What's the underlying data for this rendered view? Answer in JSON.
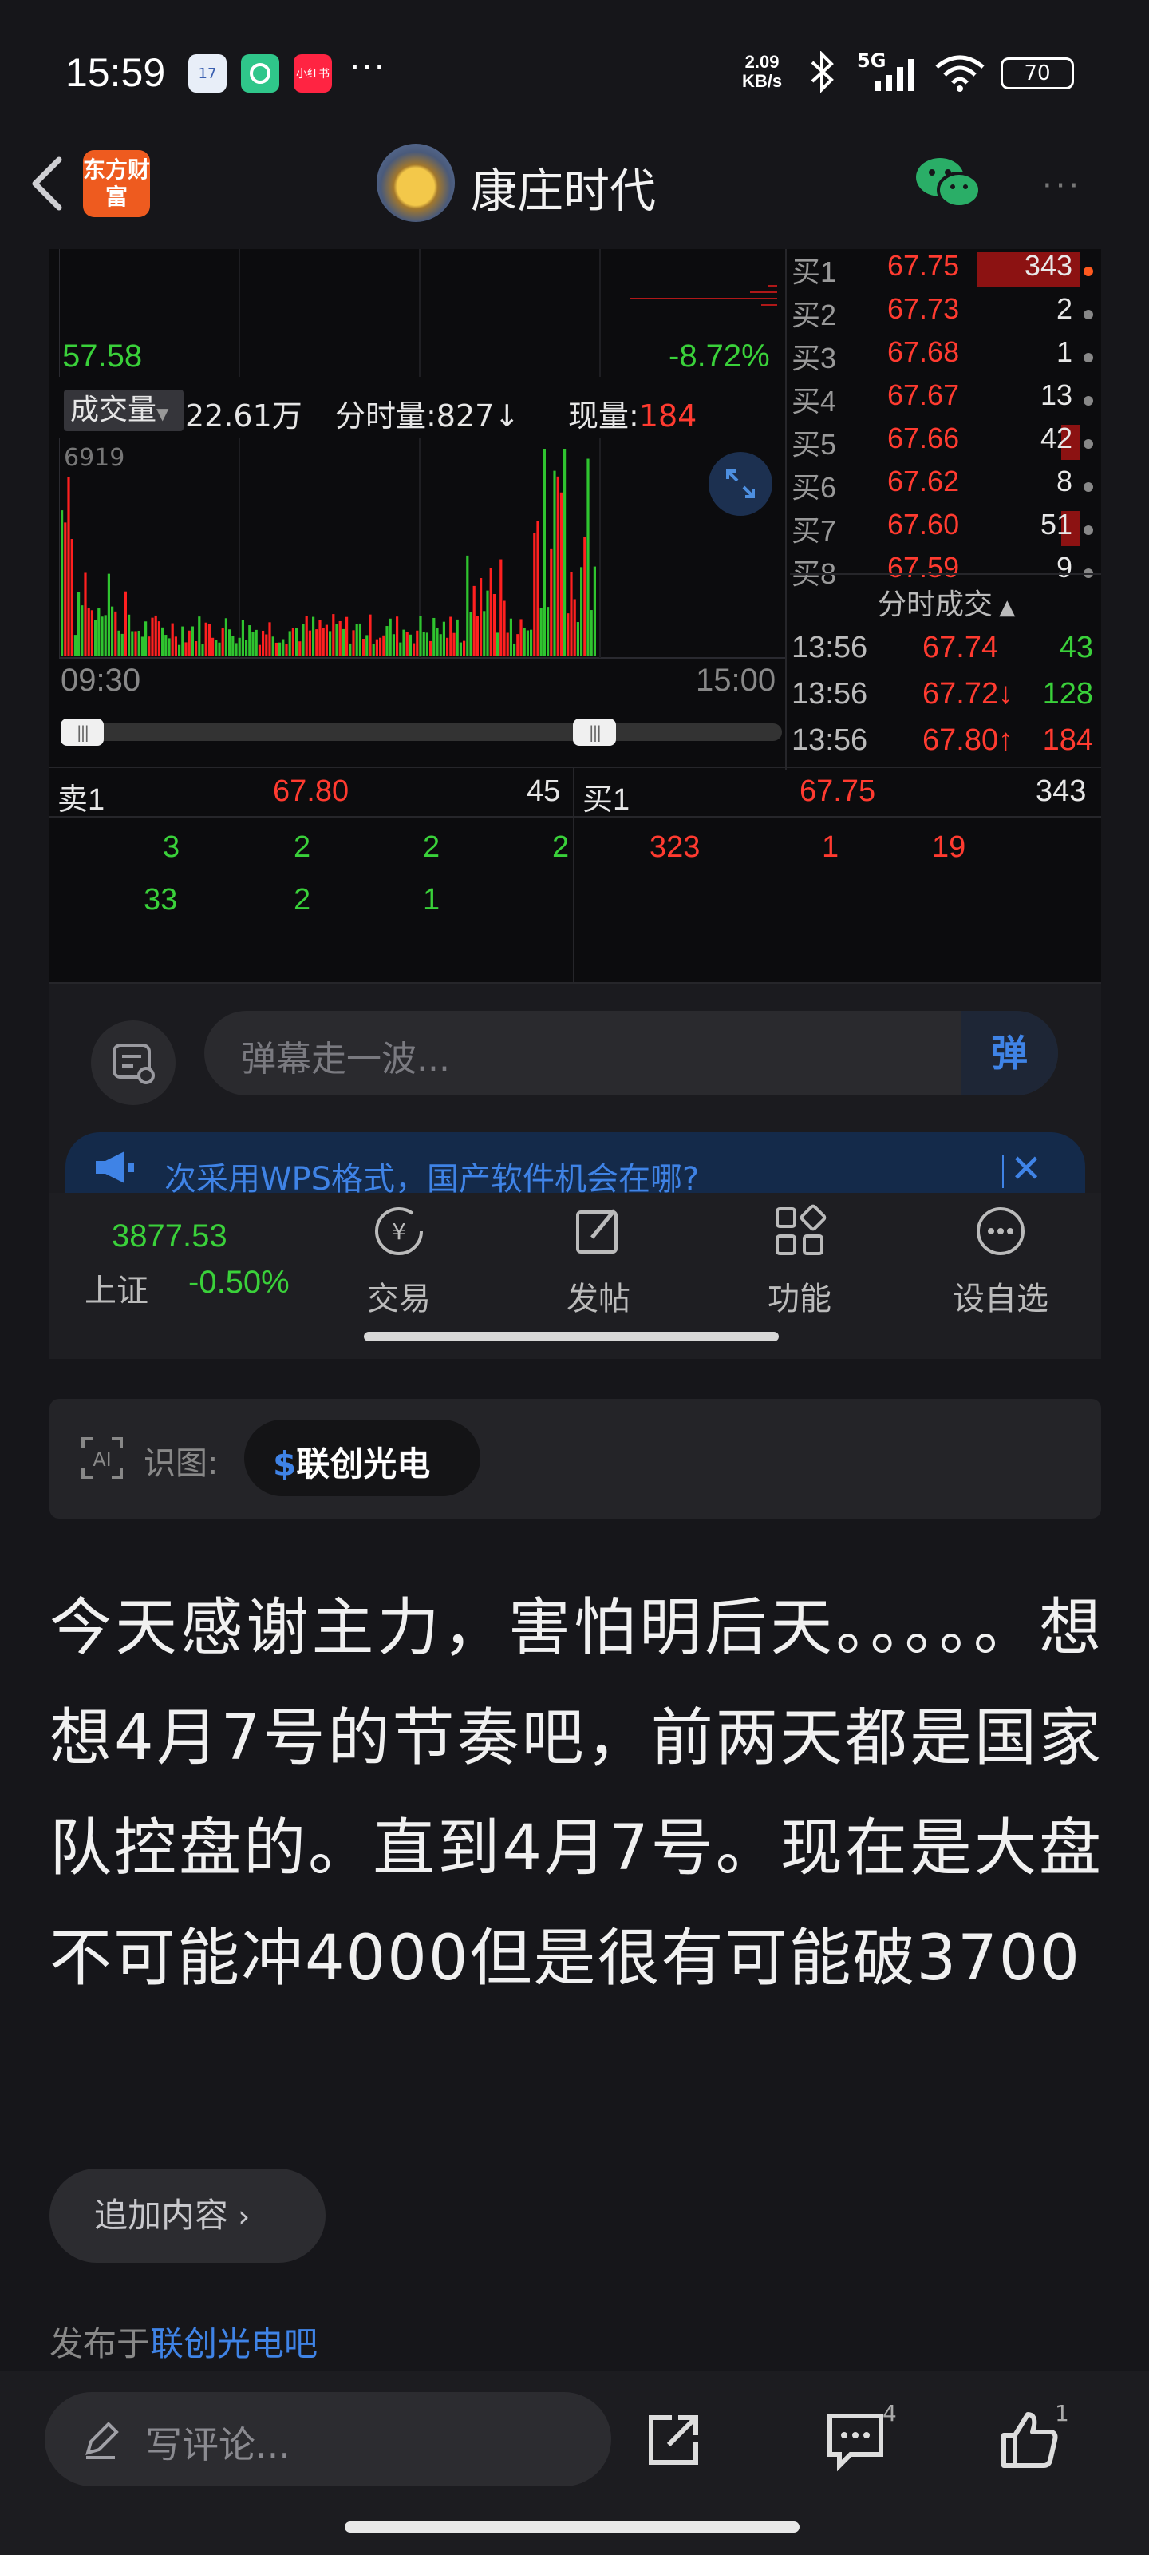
{
  "status_bar": {
    "time": "15:59",
    "apps": [
      "17",
      "",
      "小红书"
    ],
    "more": "···",
    "net_speed_top": "2.09",
    "net_speed_bottom": "KB/s",
    "network": "5G",
    "battery": "70"
  },
  "header": {
    "logo": "东方财富",
    "title": "康庄时代"
  },
  "stock": {
    "price_low": "57.58",
    "pct_low": "-8.72%",
    "vol_tab": "成交量",
    "vol_total": "22.61万",
    "period_vol": "分时量:827",
    "period_arrow": "↓",
    "cur_vol_label": "现量:",
    "cur_vol": "184",
    "vol_max": "6919",
    "time_start": "09:30",
    "time_end": "15:00",
    "bids": [
      {
        "label": "买1",
        "price": "67.75",
        "qty": "343"
      },
      {
        "label": "买2",
        "price": "67.73",
        "qty": "2"
      },
      {
        "label": "买3",
        "price": "67.68",
        "qty": "1"
      },
      {
        "label": "买4",
        "price": "67.67",
        "qty": "13"
      },
      {
        "label": "买5",
        "price": "67.66",
        "qty": "42"
      },
      {
        "label": "买6",
        "price": "67.62",
        "qty": "8"
      },
      {
        "label": "买7",
        "price": "67.60",
        "qty": "51"
      },
      {
        "label": "买8",
        "price": "67.59",
        "qty": "9"
      }
    ],
    "ticks_title": "分时成交",
    "ticks": [
      {
        "time": "13:56",
        "price": "67.74",
        "qty": "43"
      },
      {
        "time": "13:56",
        "price": "67.72↓",
        "qty": "128"
      },
      {
        "time": "13:56",
        "price": "67.80↑",
        "qty": "184"
      }
    ],
    "queue_sell": {
      "label": "卖1",
      "price": "67.80",
      "qty": "45",
      "row1": [
        "3",
        "2",
        "2",
        "2"
      ],
      "row2": [
        "33",
        "2",
        "1"
      ]
    },
    "queue_buy": {
      "label": "买1",
      "price": "67.75",
      "qty": "343",
      "row1": [
        "323",
        "1",
        "19"
      ]
    }
  },
  "danmaku": {
    "placeholder": "弹幕走一波...",
    "send": "弹",
    "news": "次采用WPS格式，国产软件机会在哪?"
  },
  "embedded_nav": {
    "index_value": "3877.53",
    "index_name": "上证",
    "index_pct": "-0.50%",
    "items": [
      "交易",
      "发帖",
      "功能",
      "设自选"
    ]
  },
  "ocr": {
    "label": "识图:",
    "stock": "联创光电"
  },
  "post": {
    "body": "今天感谢主力，害怕明后天。。。。。想想4月7号的节奏吧，前两天都是国家队控盘的。直到4月7号。现在是大盘不可能冲4000但是很有可能破3700",
    "add_more": "追加内容",
    "posted_prefix": "发布于",
    "posted_bar": "联创光电吧"
  },
  "comment_bar": {
    "placeholder": "写评论...",
    "comment_count": "4",
    "like_count": "1"
  },
  "colors": {
    "up": "#ff3b30",
    "down": "#3ad13a",
    "accent": "#3f83e6"
  }
}
